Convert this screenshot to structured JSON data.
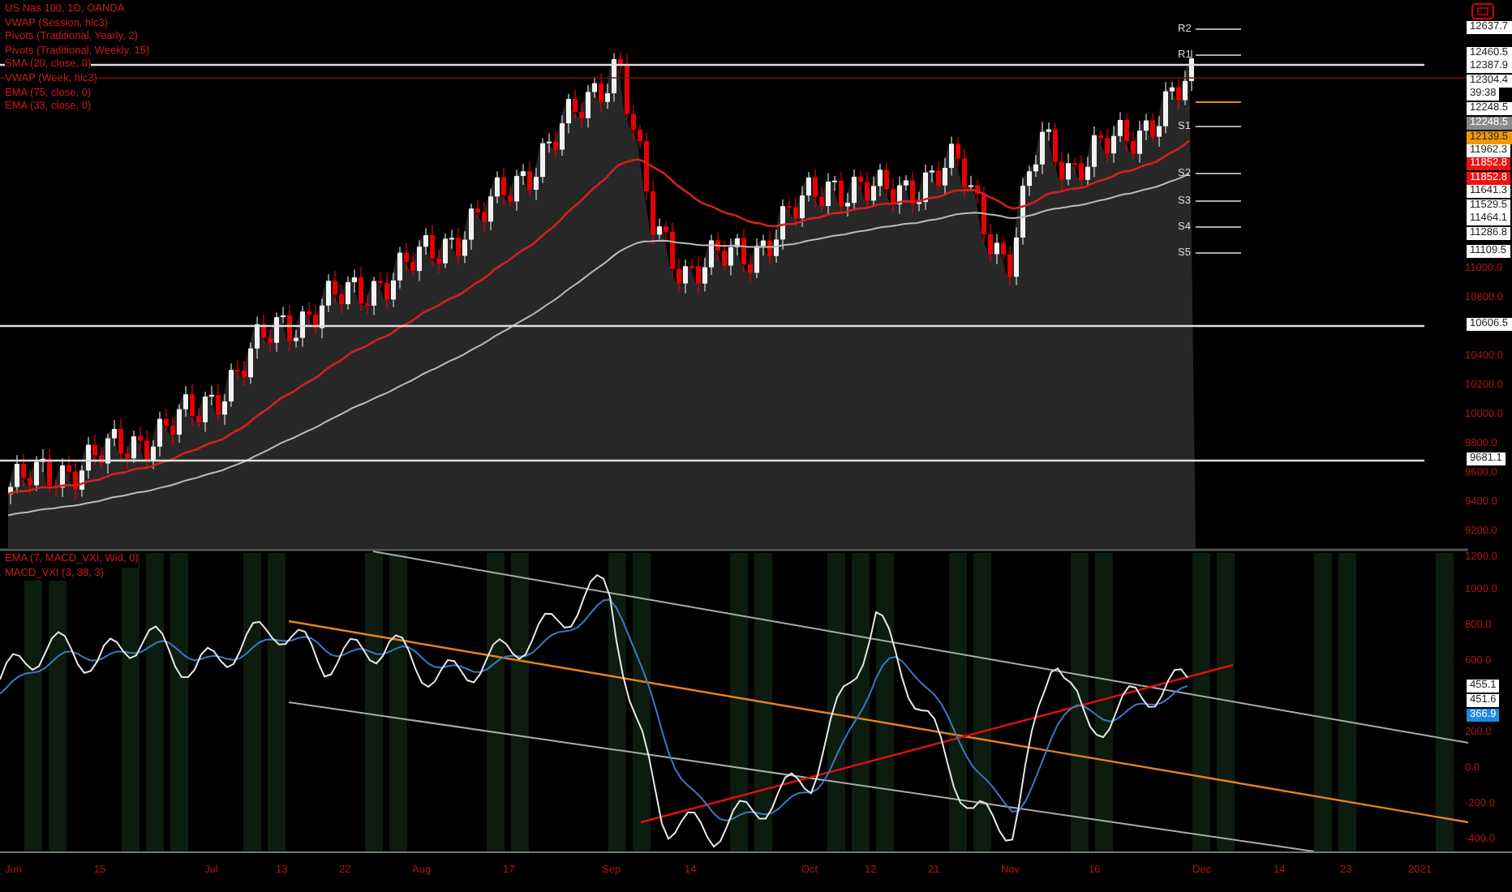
{
  "price_legend": [
    "US Nas 100, 1D, OANDA",
    "VWAP (Session, hlc3)",
    "Pivots (Traditional, Yearly, 2)",
    "Pivots (Traditional, Weekly, 15)",
    "SMA (20, close, 0)",
    "VWAP (Week, hlc3)",
    "EMA (75, close, 0)",
    "EMA (33, close, 0)"
  ],
  "pivot_labels": [
    "R2",
    "R1",
    "S1",
    "S2",
    "S3",
    "S4",
    "S5"
  ],
  "price_tags": [
    {
      "text": "12637.7",
      "kind": "plain"
    },
    {
      "text": "12460.5",
      "kind": "plain"
    },
    {
      "text": "12387.9",
      "kind": "plain"
    },
    {
      "text": "12304.4",
      "kind": "plain"
    },
    {
      "text": "39:38",
      "kind": "plain"
    },
    {
      "text": "12248.5",
      "kind": "plain"
    },
    {
      "text": "12248.5",
      "kind": "grey"
    },
    {
      "text": "12139.5",
      "kind": "orange"
    },
    {
      "text": "11962.3",
      "kind": "plain"
    },
    {
      "text": "11852.8",
      "kind": "red"
    },
    {
      "text": "11852.8",
      "kind": "red"
    },
    {
      "text": "11641.3",
      "kind": "plain"
    },
    {
      "text": "11529.5",
      "kind": "plain"
    },
    {
      "text": "11464.1",
      "kind": "plain"
    },
    {
      "text": "11286.8",
      "kind": "plain"
    },
    {
      "text": "11109.5",
      "kind": "plain"
    },
    {
      "text": "10606.5",
      "kind": "plain"
    },
    {
      "text": "9681.1",
      "kind": "plain"
    }
  ],
  "price_axis": [
    "11000.0",
    "10800.0",
    "10400.0",
    "10200.0",
    "10000.0",
    "9800.0",
    "9600.0",
    "9400.0",
    "9200.0"
  ],
  "indicator_legend": [
    "EMA (7, MACD_VXI, Wid, 0)",
    "MACD_VXI (3, 38, 3)"
  ],
  "indicator_axis": [
    "1200.0",
    "1000.0",
    "800.0",
    "600.0",
    "200.0",
    "0.0",
    "-200.0",
    "-400.0"
  ],
  "indicator_tags": [
    {
      "text": "455.1",
      "kind": "plain"
    },
    {
      "text": "451.6",
      "kind": "plain"
    },
    {
      "text": "366.9",
      "kind": "blue"
    }
  ],
  "time_axis": [
    "Jun",
    "15",
    "Jul",
    "13",
    "22",
    "Aug",
    "17",
    "Sep",
    "14",
    "Oct",
    "12",
    "21",
    "Nov",
    "16",
    "Dec",
    "14",
    "23",
    "2021"
  ]
}
